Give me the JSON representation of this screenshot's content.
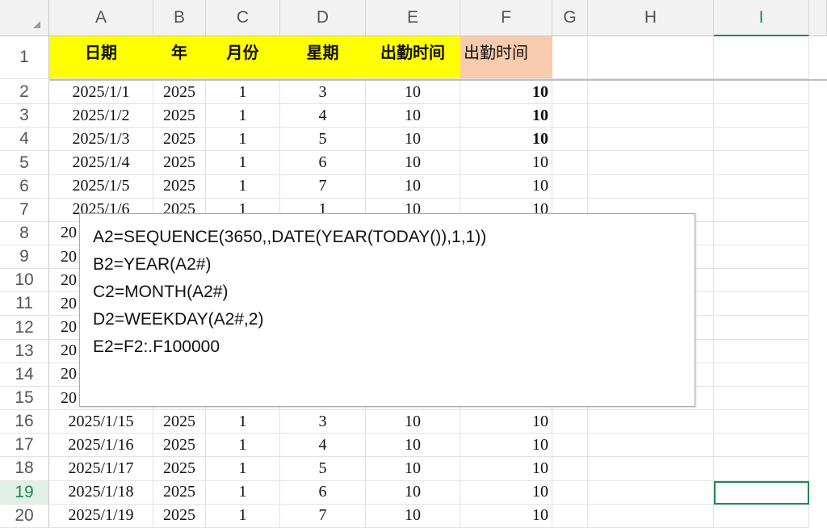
{
  "columns": [
    "A",
    "B",
    "C",
    "D",
    "E",
    "F",
    "G",
    "H",
    "I"
  ],
  "selected_column": "I",
  "selected_row": 19,
  "header_row": {
    "row": 1,
    "cells": [
      "日期",
      "年",
      "月份",
      "星期",
      "出勤时间",
      "出勤时间"
    ],
    "fill_colors": [
      "#ffff00",
      "#ffff00",
      "#ffff00",
      "#ffff00",
      "#ffff00",
      "#f8cbad"
    ]
  },
  "rows": [
    {
      "row": 2,
      "cells": [
        "2025/1/1",
        "2025",
        "1",
        "3",
        "10",
        "10"
      ]
    },
    {
      "row": 3,
      "cells": [
        "2025/1/2",
        "2025",
        "1",
        "4",
        "10",
        "10"
      ]
    },
    {
      "row": 4,
      "cells": [
        "2025/1/3",
        "2025",
        "1",
        "5",
        "10",
        "10"
      ]
    },
    {
      "row": 5,
      "cells": [
        "2025/1/4",
        "2025",
        "1",
        "6",
        "10",
        "10"
      ]
    },
    {
      "row": 6,
      "cells": [
        "2025/1/5",
        "2025",
        "1",
        "7",
        "10",
        "10"
      ]
    },
    {
      "row": 7,
      "cells": [
        "2025/1/6",
        "2025",
        "1",
        "1",
        "10",
        "10"
      ]
    },
    {
      "row": 8,
      "cells": [
        "20",
        "",
        "",
        "",
        "",
        ""
      ]
    },
    {
      "row": 9,
      "cells": [
        "20",
        "",
        "",
        "",
        "",
        ""
      ]
    },
    {
      "row": 10,
      "cells": [
        "20",
        "",
        "",
        "",
        "",
        ""
      ]
    },
    {
      "row": 11,
      "cells": [
        "20",
        "",
        "",
        "",
        "",
        ""
      ]
    },
    {
      "row": 12,
      "cells": [
        "20",
        "",
        "",
        "",
        "",
        ""
      ]
    },
    {
      "row": 13,
      "cells": [
        "20",
        "",
        "",
        "",
        "",
        ""
      ]
    },
    {
      "row": 14,
      "cells": [
        "20",
        "",
        "",
        "",
        "",
        ""
      ]
    },
    {
      "row": 15,
      "cells": [
        "20",
        "",
        "",
        "",
        "",
        ""
      ]
    },
    {
      "row": 16,
      "cells": [
        "2025/1/15",
        "2025",
        "1",
        "3",
        "10",
        "10"
      ]
    },
    {
      "row": 17,
      "cells": [
        "2025/1/16",
        "2025",
        "1",
        "4",
        "10",
        "10"
      ]
    },
    {
      "row": 18,
      "cells": [
        "2025/1/17",
        "2025",
        "1",
        "5",
        "10",
        "10"
      ]
    },
    {
      "row": 19,
      "cells": [
        "2025/1/18",
        "2025",
        "1",
        "6",
        "10",
        "10"
      ]
    },
    {
      "row": 20,
      "cells": [
        "2025/1/19",
        "2025",
        "1",
        "7",
        "10",
        "10"
      ]
    }
  ],
  "bold_f_rows": [
    2,
    3,
    4
  ],
  "formula_note": {
    "lines": [
      "A2=SEQUENCE(3650,,DATE(YEAR(TODAY()),1,1))",
      "B2=YEAR(A2#)",
      "C2=MONTH(A2#)",
      "D2=WEEKDAY(A2#,2)",
      "E2=F2:.F100000"
    ]
  },
  "colors": {
    "selection_green": "#1e8a4e",
    "header_yellow": "#ffff00",
    "header_peach": "#f8cbad"
  }
}
